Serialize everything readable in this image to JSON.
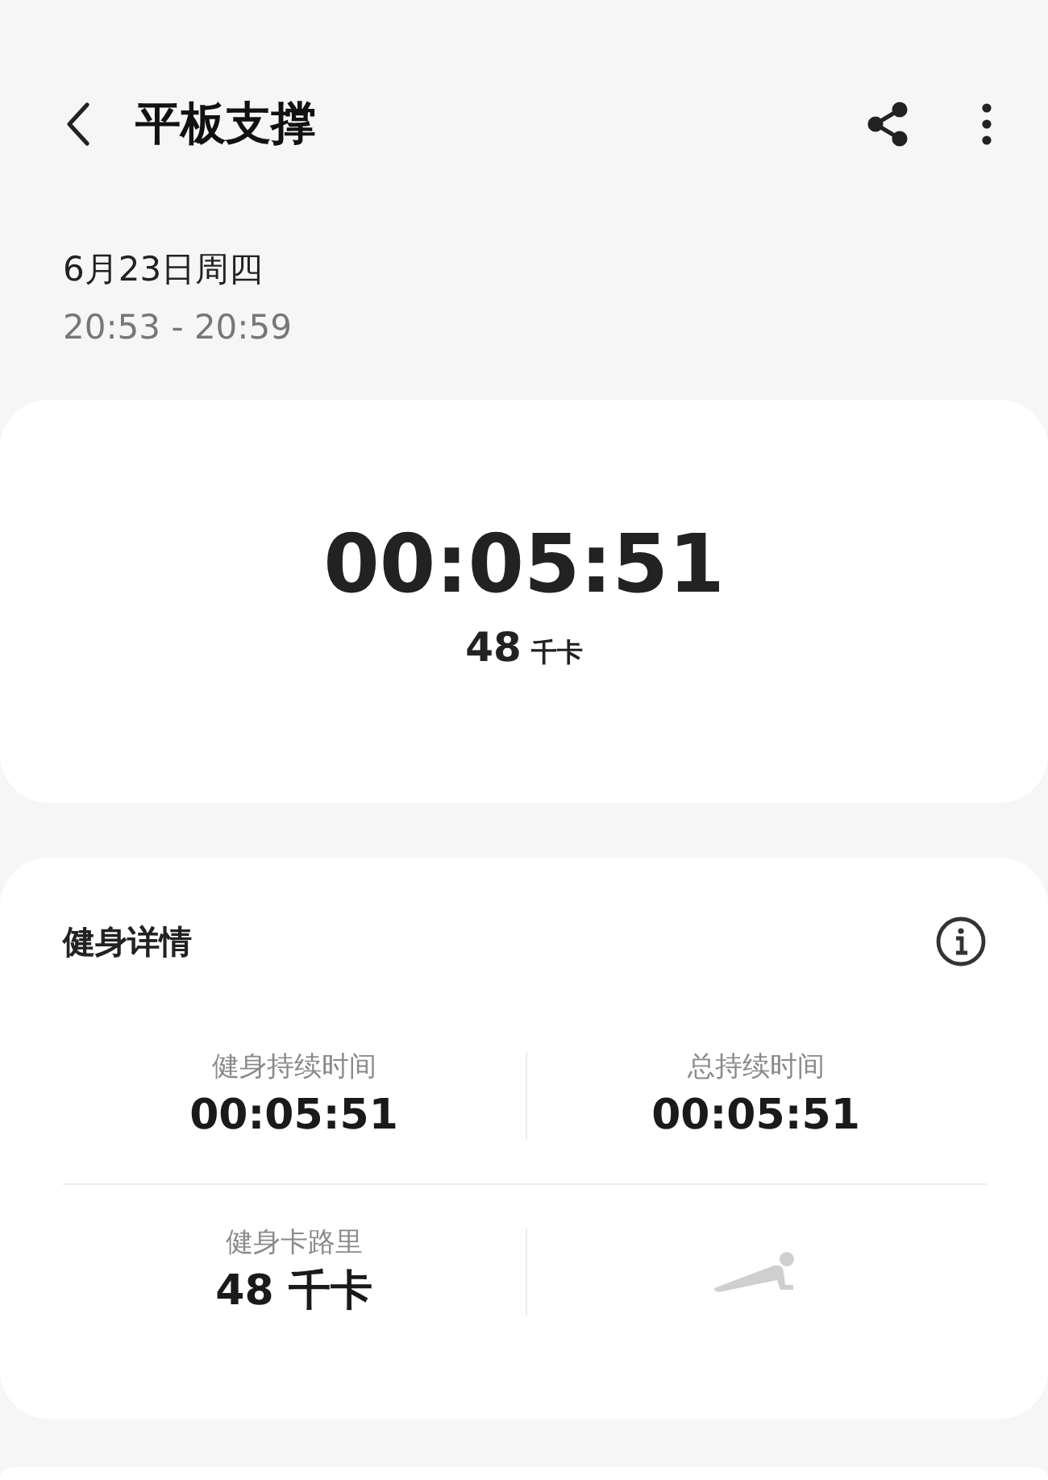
{
  "header": {
    "title": "平板支撑"
  },
  "session": {
    "date": "6月23日周四",
    "time_range": "20:53 - 20:59"
  },
  "summary": {
    "duration": "00:05:51",
    "calories_value": "48",
    "calories_unit": "千卡"
  },
  "details": {
    "title": "健身详情",
    "cells": [
      {
        "kind": "stat",
        "label": "健身持续时间",
        "value": "00:05:51"
      },
      {
        "kind": "stat",
        "label": "总持续时间",
        "value": "00:05:51"
      },
      {
        "kind": "stat",
        "label": "健身卡路里",
        "value": "48 千卡"
      },
      {
        "kind": "figure"
      }
    ]
  }
}
